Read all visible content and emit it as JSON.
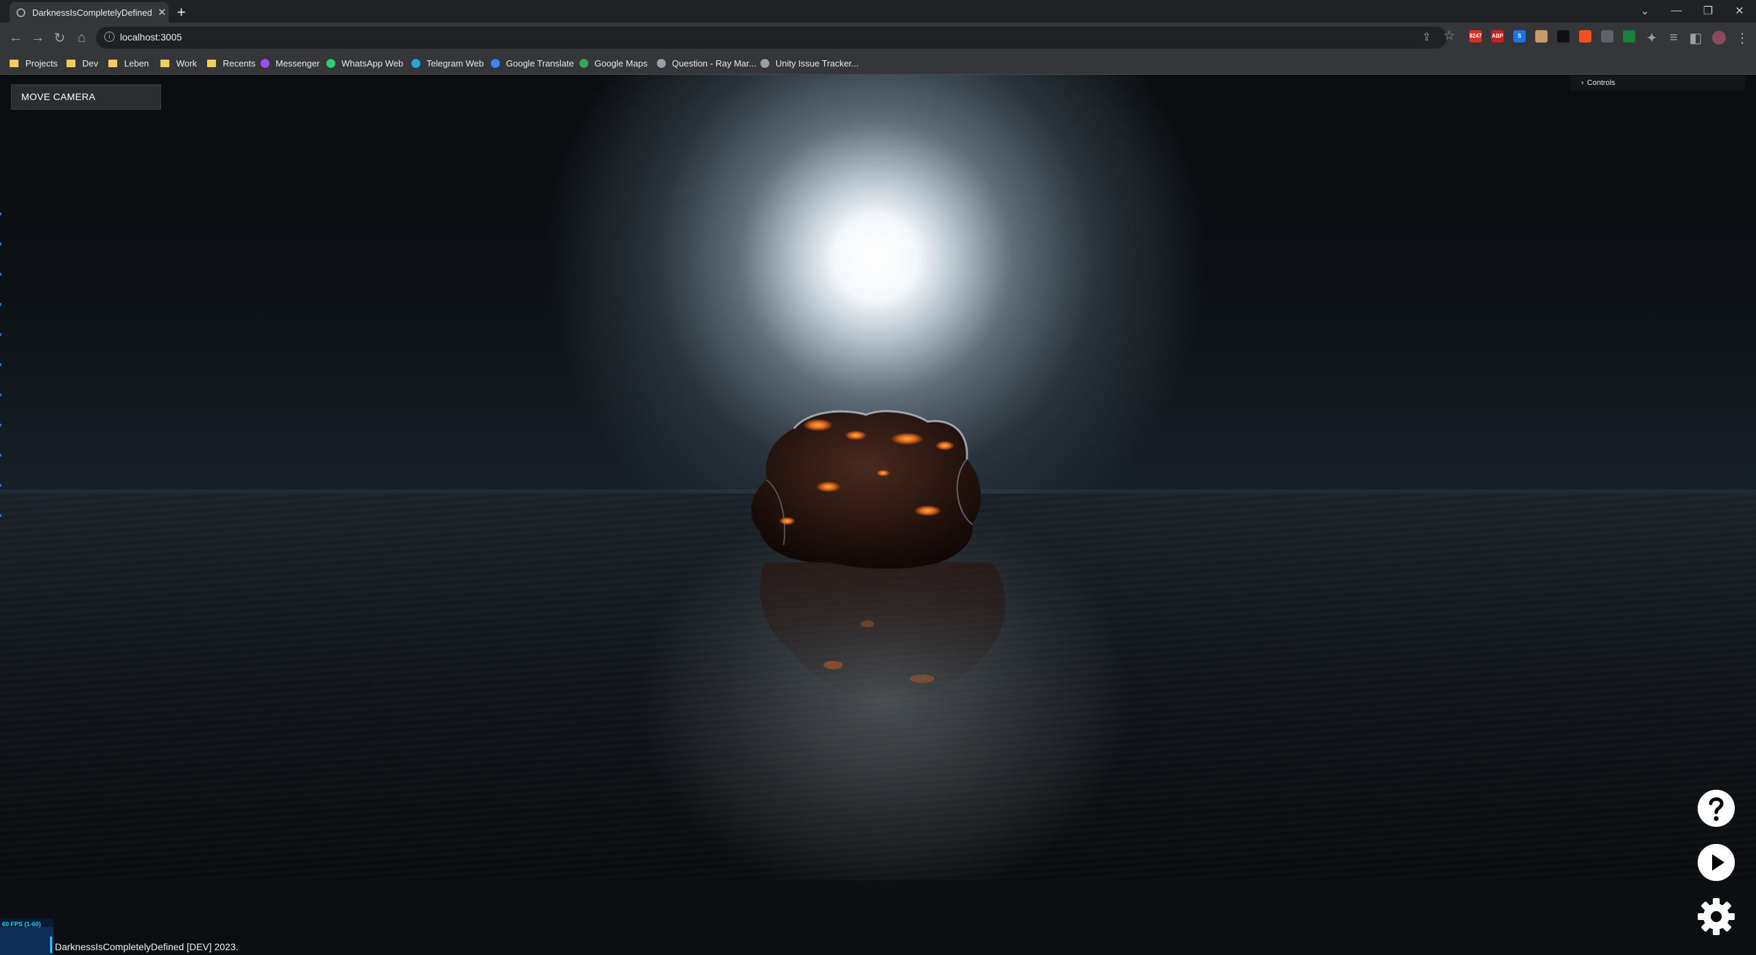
{
  "browser": {
    "tab_title": "DarknessIsCompletelyDefined [DEV]",
    "url": "localhost:3005",
    "new_tab_icon": "+",
    "bookmarks": [
      {
        "label": "Projects",
        "kind": "folder"
      },
      {
        "label": "Dev",
        "kind": "folder"
      },
      {
        "label": "Leben",
        "kind": "folder"
      },
      {
        "label": "Work",
        "kind": "folder"
      },
      {
        "label": "Recents",
        "kind": "folder"
      },
      {
        "label": "Messenger",
        "kind": "site",
        "color": "#a34bf0"
      },
      {
        "label": "WhatsApp Web",
        "kind": "site",
        "color": "#25d366"
      },
      {
        "label": "Telegram Web",
        "kind": "site",
        "color": "#2aa4e0"
      },
      {
        "label": "Google Translate",
        "kind": "site",
        "color": "#4285f4"
      },
      {
        "label": "Google Maps",
        "kind": "site",
        "color": "#34a853"
      },
      {
        "label": "Question - Ray Mar...",
        "kind": "site",
        "color": "#9aa0a6"
      },
      {
        "label": "Unity Issue Tracker...",
        "kind": "site",
        "color": "#9aa0a6"
      }
    ],
    "extensions": [
      {
        "name": "gmail-badge-extension",
        "label": "8247",
        "color": "#d93025"
      },
      {
        "name": "adblock-plus-extension",
        "label": "ABP",
        "color": "#c5221f"
      },
      {
        "name": "blue-extension",
        "label": "S",
        "color": "#1a73e8"
      },
      {
        "name": "tan-extension",
        "label": "",
        "color": "#c69c6d"
      },
      {
        "name": "dark-extension",
        "label": "",
        "color": "#111111"
      },
      {
        "name": "orange-extension",
        "label": "",
        "color": "#f4511e"
      },
      {
        "name": "camera-extension",
        "label": "",
        "color": "#5f6368"
      },
      {
        "name": "green-extension",
        "label": "",
        "color": "#188038"
      }
    ]
  },
  "app": {
    "move_camera_label": "MOVE CAMERA",
    "controls_label": "Controls",
    "fps_label": "60 FPS (1-60)",
    "footer": "DarknessIsCompletelyDefined [DEV] 2023.",
    "colors": {
      "moon": "#ffffff",
      "rock_glow": "#e0661a",
      "rock_body": "#2a1712",
      "sea": "#12171c"
    }
  }
}
